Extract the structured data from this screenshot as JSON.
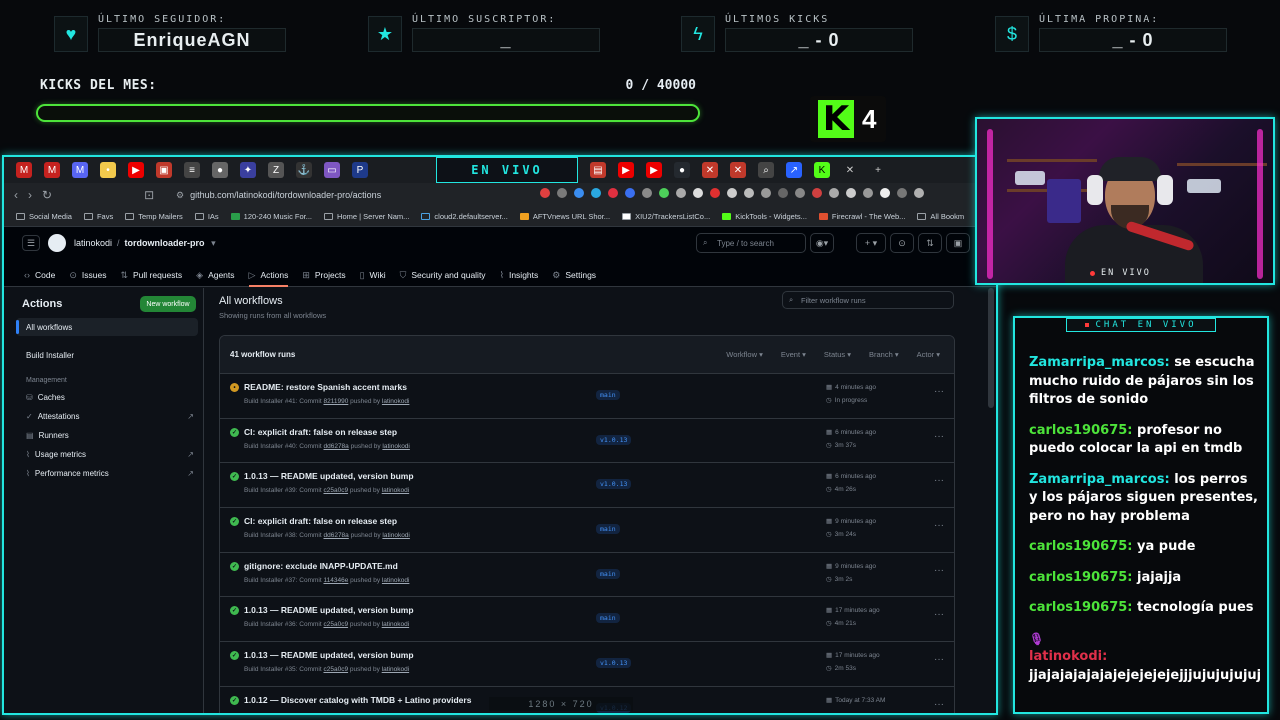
{
  "hud": {
    "stats": [
      {
        "label": "ÚLTIMO SEGUIDOR:",
        "value": "EnriqueAGN",
        "icon": "heart-icon"
      },
      {
        "label": "ÚLTIMO SUSCRIPTOR:",
        "value": "_",
        "icon": "star-icon"
      },
      {
        "label": "ÚLTIMOS KICKS",
        "value": "_ - 0",
        "icon": "bolt-icon"
      },
      {
        "label": "ÚLTIMA PROPINA:",
        "value": "_ - 0",
        "icon": "dollar-icon"
      }
    ],
    "kicks_label": "KICKS DEL MES:",
    "kicks_count": "0 / 40000",
    "kicks_progress": 0,
    "kick_badge_count": "4",
    "accent": "#22e6e0",
    "kick_green": "#53fc18"
  },
  "browser": {
    "live_tab": "EN VIVO",
    "url": "github.com/latinokodi/tordownloader-pro/actions",
    "bookmarks": [
      "Social Media",
      "Favs",
      "Temp Mailers",
      "IAs",
      "120-240 Music For...",
      "Home | Server Nam...",
      "cloud2.defaultserver...",
      "AFTVnews URL Shor...",
      "XIU2/TrackersListCo...",
      "KickTools - Widgets...",
      "Firecrawl - The Web...",
      "All Bookm"
    ]
  },
  "github": {
    "owner": "latinokodi",
    "repo": "tordownloader-pro",
    "search_placeholder": "Type / to search",
    "nav": [
      "Code",
      "Issues",
      "Pull requests",
      "Agents",
      "Actions",
      "Projects",
      "Wiki",
      "Security and quality",
      "Insights",
      "Settings"
    ],
    "sidebar": {
      "title": "Actions",
      "new_workflow": "New workflow",
      "all_workflows": "All workflows",
      "build_installer": "Build Installer",
      "management": "Management",
      "links": [
        "Caches",
        "Attestations",
        "Runners",
        "Usage metrics",
        "Performance metrics"
      ]
    },
    "main": {
      "title": "All workflows",
      "subtitle": "Showing runs from all workflows",
      "filter_placeholder": "Filter workflow runs",
      "runs_count": "41 workflow runs",
      "filters": [
        "Workflow ▾",
        "Event ▾",
        "Status ▾",
        "Branch ▾",
        "Actor ▾"
      ]
    },
    "runs": [
      {
        "title": "README: restore Spanish accent marks",
        "meta_pre": "Build Installer #41: Commit ",
        "commit": "8211990",
        "meta_mid": " pushed by ",
        "user": "latinokodi",
        "branch": "main",
        "time": "4 minutes ago",
        "dur": "In progress",
        "status": "in_progress"
      },
      {
        "title": "CI: explicit draft: false on release step",
        "meta_pre": "Build Installer #40: Commit ",
        "commit": "dd6278a",
        "meta_mid": " pushed by ",
        "user": "latinokodi",
        "branch": "v1.0.13",
        "time": "6 minutes ago",
        "dur": "3m 37s",
        "status": "success"
      },
      {
        "title": "1.0.13 — README updated, version bump",
        "meta_pre": "Build Installer #39: Commit ",
        "commit": "c25a0c9",
        "meta_mid": " pushed by ",
        "user": "latinokodi",
        "branch": "v1.0.13",
        "time": "6 minutes ago",
        "dur": "4m 26s",
        "status": "success"
      },
      {
        "title": "CI: explicit draft: false on release step",
        "meta_pre": "Build Installer #38: Commit ",
        "commit": "dd6278a",
        "meta_mid": " pushed by ",
        "user": "latinokodi",
        "branch": "main",
        "time": "9 minutes ago",
        "dur": "3m 24s",
        "status": "success"
      },
      {
        "title": "gitignore: exclude INAPP-UPDATE.md",
        "meta_pre": "Build Installer #37: Commit ",
        "commit": "114346e",
        "meta_mid": " pushed by ",
        "user": "latinokodi",
        "branch": "main",
        "time": "9 minutes ago",
        "dur": "3m 2s",
        "status": "success"
      },
      {
        "title": "1.0.13 — README updated, version bump",
        "meta_pre": "Build Installer #36: Commit ",
        "commit": "c25a0c9",
        "meta_mid": " pushed by ",
        "user": "latinokodi",
        "branch": "main",
        "time": "17 minutes ago",
        "dur": "4m 21s",
        "status": "success"
      },
      {
        "title": "1.0.13 — README updated, version bump",
        "meta_pre": "Build Installer #35: Commit ",
        "commit": "c25a0c9",
        "meta_mid": " pushed by ",
        "user": "latinokodi",
        "branch": "v1.0.13",
        "time": "17 minutes ago",
        "dur": "2m 53s",
        "status": "success"
      },
      {
        "title": "1.0.12 — Discover catalog with TMDB + Latino providers",
        "meta_pre": "",
        "commit": "",
        "meta_mid": "",
        "user": "",
        "branch": "v1.0.12",
        "time": "Today at 7:33 AM",
        "dur": "",
        "status": "success"
      }
    ],
    "resolution_overlay": "1280 × 720"
  },
  "cam": {
    "label": "EN VIVO"
  },
  "chat": {
    "title": "CHAT EN VIVO",
    "messages": [
      {
        "user": "Zamarripa_marcos:",
        "text": " se escucha mucho ruido de pájaros sin los filtros de sonido",
        "color": "#22e6e0"
      },
      {
        "user": "carlos190675:",
        "text": " profesor no puedo colocar la api en tmdb",
        "color": "#4de43a"
      },
      {
        "user": "Zamarripa_marcos:",
        "text": " los perros y los pájaros siguen presentes, pero no hay problema",
        "color": "#22e6e0"
      },
      {
        "user": "carlos190675:",
        "text": " ya pude",
        "color": "#4de43a"
      },
      {
        "user": "carlos190675:",
        "text": " jajajja",
        "color": "#4de43a"
      },
      {
        "user": "carlos190675:",
        "text": " tecnología pues",
        "color": "#4de43a"
      },
      {
        "user": "latinokodi:",
        "text": " jjajajajajajajejejejejejjjujujujujuj",
        "color": "#e0304a",
        "icon": "microphone-icon"
      }
    ]
  }
}
